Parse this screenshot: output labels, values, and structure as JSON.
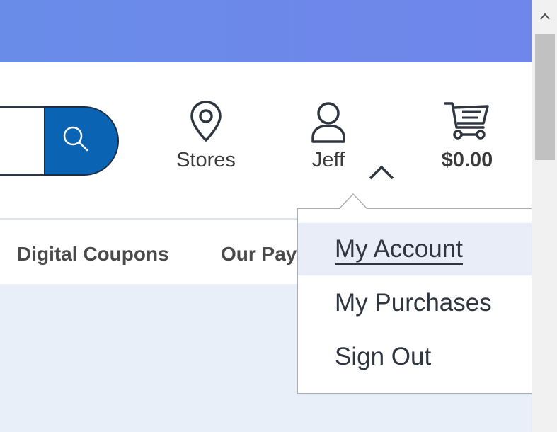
{
  "header": {
    "search": {
      "value": "",
      "placeholder": ""
    },
    "tools": {
      "stores_label": "Stores",
      "account_label": "Jeff",
      "cart_total": "$0.00"
    }
  },
  "subnav": {
    "items": [
      {
        "label": "Digital Coupons"
      },
      {
        "label": "Our Pay"
      }
    ]
  },
  "account_menu": {
    "items": [
      {
        "label": "My Account",
        "active": true
      },
      {
        "label": "My Purchases"
      },
      {
        "label": "Sign Out"
      }
    ]
  },
  "icons": {
    "search": "search-icon",
    "stores": "location-pin-icon",
    "account": "user-icon",
    "cart": "cart-icon",
    "menu_toggle": "chevron-up-icon",
    "scroll_up": "scroll-up-arrow-icon"
  },
  "colors": {
    "banner": "#6a8ce9",
    "search_button": "#0b63b3",
    "menu_active_bg": "#e8edf7",
    "content_bg": "#e9eff8"
  }
}
